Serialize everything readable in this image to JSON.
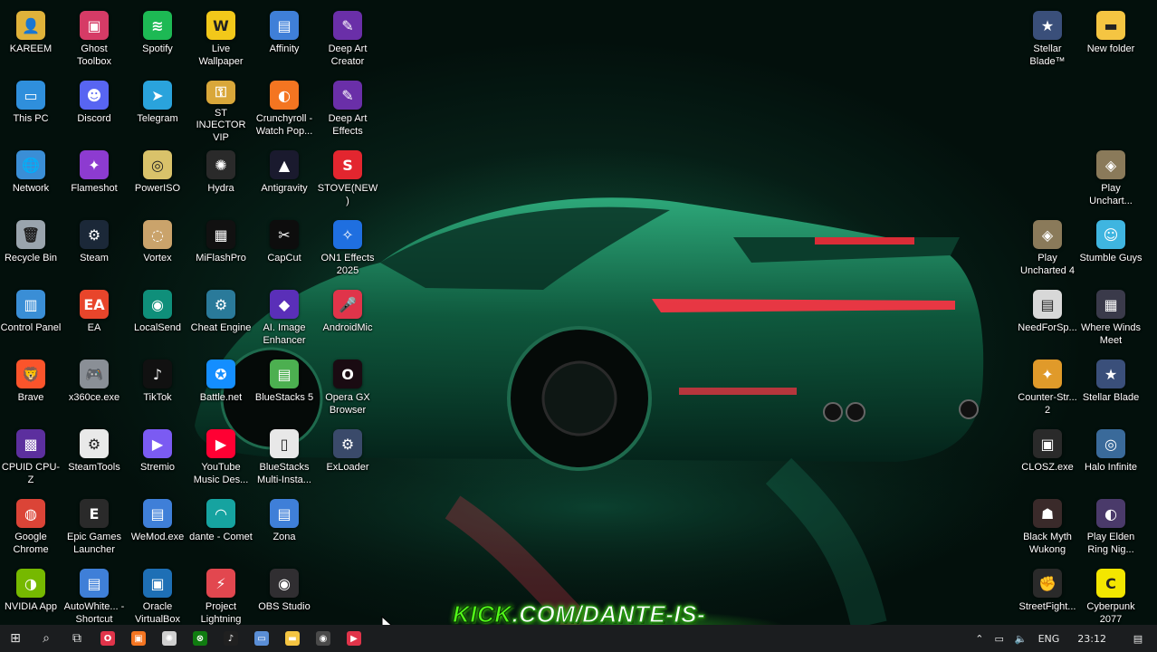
{
  "desktop": {
    "icons": [
      {
        "label": "KAREEM",
        "icon": "user-folder-icon",
        "color": "#e0b23a",
        "glyph": "👤"
      },
      {
        "label": "Ghost Toolbox",
        "icon": "ghost-toolbox-icon",
        "color": "#d63b66",
        "glyph": "▣"
      },
      {
        "label": "Spotify",
        "icon": "spotify-icon",
        "color": "#1db954",
        "glyph": "≋"
      },
      {
        "label": "Live Wallpaper",
        "icon": "live-wallpaper-icon",
        "color": "#f2c81a",
        "glyph": "W"
      },
      {
        "label": "Affinity",
        "icon": "affinity-shortcut-icon",
        "color": "#3f7fd8",
        "glyph": "▤"
      },
      {
        "label": "Deep Art Creator",
        "icon": "deep-art-creator-icon",
        "color": "#6a2fa8",
        "glyph": "✎"
      },
      {
        "label": "This PC",
        "icon": "this-pc-icon",
        "color": "#2f8fdc",
        "glyph": "▭"
      },
      {
        "label": "Discord",
        "icon": "discord-icon",
        "color": "#5865f2",
        "glyph": "☻"
      },
      {
        "label": "Telegram",
        "icon": "telegram-icon",
        "color": "#2aa3dc",
        "glyph": "➤"
      },
      {
        "label": "ST INJECTOR VIP",
        "icon": "injector-icon",
        "color": "#d9a73a",
        "glyph": "⚿"
      },
      {
        "label": "Crunchyroll - Watch Pop...",
        "icon": "crunchyroll-icon",
        "color": "#f47521",
        "glyph": "◐"
      },
      {
        "label": "Deep Art Effects",
        "icon": "deep-art-effects-icon",
        "color": "#6a2fa8",
        "glyph": "✎"
      },
      {
        "label": "Network",
        "icon": "network-icon",
        "color": "#3a8ed6",
        "glyph": "🌐"
      },
      {
        "label": "Flameshot",
        "icon": "flameshot-icon",
        "color": "#8d3bd0",
        "glyph": "✦"
      },
      {
        "label": "PowerISO",
        "icon": "poweriso-icon",
        "color": "#d9c26a",
        "glyph": "◎"
      },
      {
        "label": "Hydra",
        "icon": "hydra-icon",
        "color": "#2a2a2a",
        "glyph": "✺"
      },
      {
        "label": "Antigravity",
        "icon": "antigravity-icon",
        "color": "#1a1a2e",
        "glyph": "▲"
      },
      {
        "label": "STOVE(NEW)",
        "icon": "stove-icon",
        "color": "#e3262f",
        "glyph": "S"
      },
      {
        "label": "Recycle Bin",
        "icon": "recycle-bin-icon",
        "color": "#9aa4ad",
        "glyph": "🗑"
      },
      {
        "label": "Steam",
        "icon": "steam-icon",
        "color": "#1b2838",
        "glyph": "⚙"
      },
      {
        "label": "Vortex",
        "icon": "vortex-icon",
        "color": "#caa36b",
        "glyph": "◌"
      },
      {
        "label": "MiFlashPro",
        "icon": "miflashpro-icon",
        "color": "#111111",
        "glyph": "▦"
      },
      {
        "label": "CapCut",
        "icon": "capcut-icon",
        "color": "#0d0d0d",
        "glyph": "✂"
      },
      {
        "label": "ON1 Effects 2025",
        "icon": "on1-effects-icon",
        "color": "#1f6fe0",
        "glyph": "✧"
      },
      {
        "label": "Control Panel",
        "icon": "control-panel-icon",
        "color": "#3a8ed6",
        "glyph": "▥"
      },
      {
        "label": "EA",
        "icon": "ea-icon",
        "color": "#e8452b",
        "glyph": "EA"
      },
      {
        "label": "LocalSend",
        "icon": "localsend-icon",
        "color": "#0f8f7a",
        "glyph": "◉"
      },
      {
        "label": "Cheat Engine",
        "icon": "cheat-engine-icon",
        "color": "#2a7a9a",
        "glyph": "⚙"
      },
      {
        "label": "AI. Image Enhancer",
        "icon": "ai-image-enhancer-icon",
        "color": "#5a2fb8",
        "glyph": "◆"
      },
      {
        "label": "AndroidMic",
        "icon": "androidmic-icon",
        "color": "#e0344a",
        "glyph": "🎤"
      },
      {
        "label": "Brave",
        "icon": "brave-icon",
        "color": "#fb542b",
        "glyph": "🦁"
      },
      {
        "label": "x360ce.exe",
        "icon": "gamepad-icon",
        "color": "#8a8f96",
        "glyph": "🎮"
      },
      {
        "label": "TikTok",
        "icon": "tiktok-icon",
        "color": "#111111",
        "glyph": "♪"
      },
      {
        "label": "Battle.net",
        "icon": "battlenet-icon",
        "color": "#148eff",
        "glyph": "✪"
      },
      {
        "label": "BlueStacks 5",
        "icon": "bluestacks-icon",
        "color": "#4caf50",
        "glyph": "▤"
      },
      {
        "label": "Opera GX Browser",
        "icon": "opera-gx-icon",
        "color": "#1a0b12",
        "glyph": "O"
      },
      {
        "label": "CPUID CPU-Z",
        "icon": "cpuz-icon",
        "color": "#5c2f9e",
        "glyph": "▩"
      },
      {
        "label": "SteamTools",
        "icon": "steamtools-icon",
        "color": "#e9e9e9",
        "glyph": "⚙"
      },
      {
        "label": "Stremio",
        "icon": "stremio-icon",
        "color": "#7b5bf2",
        "glyph": "▶"
      },
      {
        "label": "YouTube Music Des...",
        "icon": "youtube-music-icon",
        "color": "#ff0033",
        "glyph": "▶"
      },
      {
        "label": "BlueStacks Multi-Insta...",
        "icon": "file-icon",
        "color": "#e8e8e8",
        "glyph": "▯"
      },
      {
        "label": "ExLoader",
        "icon": "exloader-icon",
        "color": "#3a4a6a",
        "glyph": "⚙"
      },
      {
        "label": "Google Chrome",
        "icon": "chrome-icon",
        "color": "#db4437",
        "glyph": "◍"
      },
      {
        "label": "Epic Games Launcher",
        "icon": "epic-games-icon",
        "color": "#2a2a2a",
        "glyph": "E"
      },
      {
        "label": "WeMod.exe",
        "icon": "wemod-shortcut-icon",
        "color": "#3f7fd8",
        "glyph": "▤"
      },
      {
        "label": "dante - Comet",
        "icon": "comet-icon",
        "color": "#16a3a0",
        "glyph": "◠"
      },
      {
        "label": "Zona",
        "icon": "zona-shortcut-icon",
        "color": "#3f7fd8",
        "glyph": "▤"
      },
      {
        "label": "NVIDIA App",
        "icon": "nvidia-icon",
        "color": "#76b900",
        "glyph": "◑"
      },
      {
        "label": "AutoWhite... - Shortcut",
        "icon": "shortcut-icon",
        "color": "#3f7fd8",
        "glyph": "▤"
      },
      {
        "label": "Oracle VirtualBox",
        "icon": "virtualbox-icon",
        "color": "#1e6fb5",
        "glyph": "▣"
      },
      {
        "label": "Project Lightning",
        "icon": "project-lightning-icon",
        "color": "#e2474f",
        "glyph": "⚡"
      },
      {
        "label": "OBS Studio",
        "icon": "obs-icon",
        "color": "#302e31",
        "glyph": "◉"
      },
      {
        "label": "Stellar Blade™",
        "icon": "stellar-blade-icon",
        "color": "#3a4f7a",
        "glyph": "★"
      },
      {
        "label": "New folder",
        "icon": "folder-icon",
        "color": "#f5c542",
        "glyph": "▬"
      },
      {
        "label": "Play Unchart...",
        "icon": "uncharted-icon",
        "color": "#8a7a5a",
        "glyph": "◈"
      },
      {
        "label": "Play Uncharted 4",
        "icon": "uncharted-4-icon",
        "color": "#8a7a5a",
        "glyph": "◈"
      },
      {
        "label": "Stumble Guys",
        "icon": "stumble-guys-icon",
        "color": "#3fb5e0",
        "glyph": "☺"
      },
      {
        "label": "NeedForSp...",
        "icon": "need-for-speed-icon",
        "color": "#d8d8d8",
        "glyph": "▤"
      },
      {
        "label": "Where Winds Meet",
        "icon": "where-winds-meet-icon",
        "color": "#3a3a4a",
        "glyph": "▦"
      },
      {
        "label": "Counter-Str... 2",
        "icon": "counter-strike-icon",
        "color": "#e09a2a",
        "glyph": "✦"
      },
      {
        "label": "Stellar Blade",
        "icon": "stellar-blade-2-icon",
        "color": "#3a4f7a",
        "glyph": "★"
      },
      {
        "label": "CLOSZ.exe",
        "icon": "closz-icon",
        "color": "#2a2a2a",
        "glyph": "▣"
      },
      {
        "label": "Halo Infinite",
        "icon": "halo-infinite-icon",
        "color": "#3a6a9a",
        "glyph": "◎"
      },
      {
        "label": "Black Myth Wukong",
        "icon": "black-myth-wukong-icon",
        "color": "#3a2a2a",
        "glyph": "☗"
      },
      {
        "label": "Play Elden Ring Nig...",
        "icon": "elden-ring-icon",
        "color": "#4a3a6a",
        "glyph": "◐"
      },
      {
        "label": "StreetFight...",
        "icon": "street-fighter-icon",
        "color": "#2a2a2a",
        "glyph": "✊"
      },
      {
        "label": "Cyberpunk 2077",
        "icon": "cyberpunk-icon",
        "color": "#f3e600",
        "glyph": "C"
      }
    ]
  },
  "banner": {
    "brand": "KICK",
    "rest": ".COM/DANTE-IS-TROLLING"
  },
  "taskbar": {
    "apps": [
      {
        "icon": "windows-start-icon",
        "glyph": "⊞",
        "color": "#e6e6e6"
      },
      {
        "icon": "search-icon",
        "glyph": "⌕",
        "color": "#e6e6e6"
      },
      {
        "icon": "task-view-icon",
        "glyph": "⧉",
        "color": "#e6e6e6"
      },
      {
        "icon": "opera-gx-taskbar-icon",
        "glyph": "O",
        "color": "#e0344a"
      },
      {
        "icon": "app-orange-taskbar-icon",
        "glyph": "▣",
        "color": "#f47521"
      },
      {
        "icon": "chatgpt-taskbar-icon",
        "glyph": "✺",
        "color": "#cfcfcf"
      },
      {
        "icon": "xbox-taskbar-icon",
        "glyph": "⊗",
        "color": "#107c10"
      },
      {
        "icon": "tiktok-taskbar-icon",
        "glyph": "♪",
        "color": "#202020"
      },
      {
        "icon": "keyboard-taskbar-icon",
        "glyph": "▭",
        "color": "#5a8ed6"
      },
      {
        "icon": "file-explorer-taskbar-icon",
        "glyph": "▬",
        "color": "#f5c542"
      },
      {
        "icon": "obs-taskbar-icon",
        "glyph": "◉",
        "color": "#4a4a4a"
      },
      {
        "icon": "youtube-music-taskbar-icon",
        "glyph": "▶",
        "color": "#e0344a"
      }
    ],
    "tray": {
      "chevron_icon": "chevron-up-icon",
      "network_icon": "network-tray-icon",
      "volume_icon": "volume-icon",
      "language": "ENG",
      "time": "23:12",
      "notification_icon": "notification-icon"
    }
  }
}
